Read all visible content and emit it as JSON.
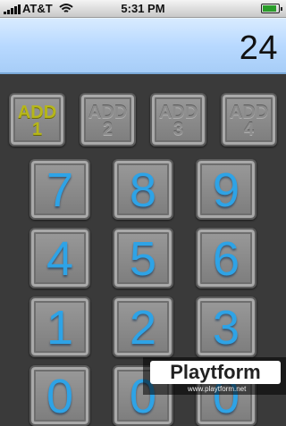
{
  "status_bar": {
    "carrier": "AT&T",
    "time": "5:31 PM",
    "signal_bars": 5,
    "battery_level": 0.9,
    "icons": [
      "signal-icon",
      "wifi-icon",
      "battery-icon"
    ]
  },
  "display": {
    "value": "24"
  },
  "add_keys": [
    {
      "label": "ADD",
      "number": "1",
      "active": true
    },
    {
      "label": "ADD",
      "number": "2",
      "active": false
    },
    {
      "label": "ADD",
      "number": "3",
      "active": false
    },
    {
      "label": "ADD",
      "number": "4",
      "active": false
    }
  ],
  "number_keys": [
    "7",
    "8",
    "9",
    "4",
    "5",
    "6",
    "1",
    "2",
    "3",
    "0",
    "0",
    "0"
  ],
  "colors": {
    "display_bg": "#b8d9ff",
    "digit": "#2ea3e6",
    "active_add": "#b6b61a",
    "inactive_add": "#8c8c8c",
    "background": "#3a3a3a"
  },
  "watermark": {
    "brand": "Playtform",
    "url": "www.playtform.net"
  }
}
